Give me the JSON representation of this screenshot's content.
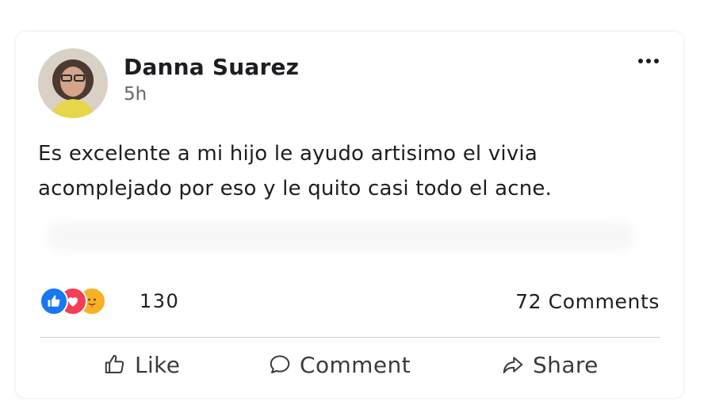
{
  "post": {
    "author": "Danna Suarez",
    "time": "5h",
    "text_line1": "Es excelente a mi hijo le ayudo artisimo el vivia",
    "text_line2": "acomplejado por eso y le quito casi todo el acne.",
    "reactions": [
      "like-icon",
      "love-icon",
      "care-icon"
    ],
    "reaction_count": "130",
    "comments_count": "72 Comments"
  },
  "actions": {
    "like": "Like",
    "comment": "Comment",
    "share": "Share"
  },
  "colors": {
    "like": "#1877f2",
    "love": "#f33e58",
    "care": "#f7b125"
  }
}
